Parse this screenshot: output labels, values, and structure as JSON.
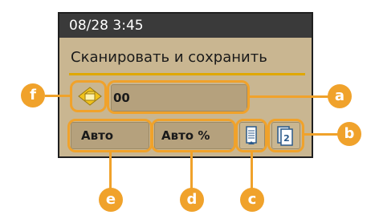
{
  "status_bar": {
    "datetime": "08/28 3:45"
  },
  "title": "Сканировать и сохранить",
  "destination_field": {
    "value": "00",
    "icon": "folder-diamond-icon"
  },
  "settings": {
    "color_mode": "Авто",
    "zoom": "Авто %",
    "orientation_icon": "document-orientation-icon",
    "two_sided_icon": "two-sided-icon"
  },
  "callouts": {
    "a": "a",
    "b": "b",
    "c": "c",
    "d": "d",
    "e": "e",
    "f": "f"
  },
  "colors": {
    "panel_bg": "#c9b691",
    "status_bar_bg": "#3a3a3a",
    "accent_underline": "#e0a800",
    "callout_orange": "#f0a22b"
  }
}
